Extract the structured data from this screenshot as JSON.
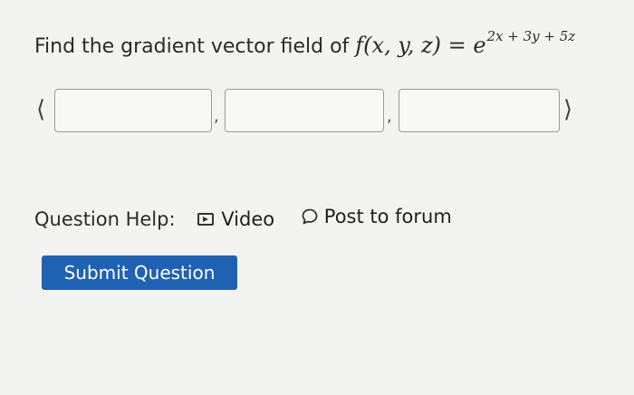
{
  "question": {
    "prefix": "Find the gradient vector field of ",
    "function_lhs": "f(x, y, z) = e",
    "exponent": "2x + 3y + 5z"
  },
  "vector": {
    "open_bracket": "⟨",
    "close_bracket": "⟩",
    "separator": ",",
    "components": [
      "",
      "",
      ""
    ]
  },
  "help": {
    "label": "Question Help:",
    "video_label": "Video",
    "forum_label": "Post to forum"
  },
  "submit": {
    "label": "Submit Question",
    "color": "#1f62b3"
  },
  "icons": {
    "video": "video-play-icon",
    "forum": "speech-bubble-icon"
  }
}
